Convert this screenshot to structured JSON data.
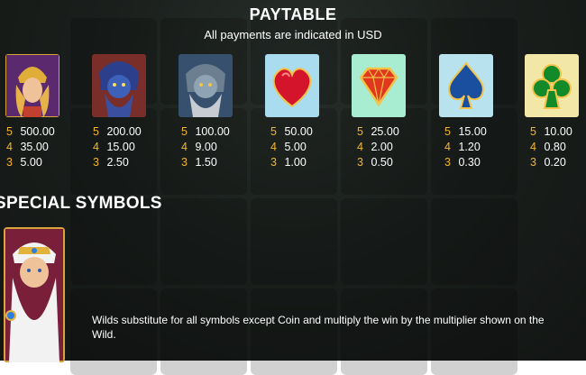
{
  "header": {
    "title": "PAYTABLE",
    "subtitle": "All payments are indicated in USD"
  },
  "symbols": [
    {
      "icon": "goddess-icon",
      "pays": [
        {
          "count": "5",
          "value": "500.00"
        },
        {
          "count": "4",
          "value": "35.00"
        },
        {
          "count": "3",
          "value": "5.00"
        }
      ]
    },
    {
      "icon": "poseidon-icon",
      "pays": [
        {
          "count": "5",
          "value": "200.00"
        },
        {
          "count": "4",
          "value": "15.00"
        },
        {
          "count": "3",
          "value": "2.50"
        }
      ]
    },
    {
      "icon": "zeus-blue-icon",
      "pays": [
        {
          "count": "5",
          "value": "100.00"
        },
        {
          "count": "4",
          "value": "9.00"
        },
        {
          "count": "3",
          "value": "1.50"
        }
      ]
    },
    {
      "icon": "heart-icon",
      "pays": [
        {
          "count": "5",
          "value": "50.00"
        },
        {
          "count": "4",
          "value": "5.00"
        },
        {
          "count": "3",
          "value": "1.00"
        }
      ]
    },
    {
      "icon": "diamond-icon",
      "pays": [
        {
          "count": "5",
          "value": "25.00"
        },
        {
          "count": "4",
          "value": "2.00"
        },
        {
          "count": "3",
          "value": "0.50"
        }
      ]
    },
    {
      "icon": "spade-icon",
      "pays": [
        {
          "count": "5",
          "value": "15.00"
        },
        {
          "count": "4",
          "value": "1.20"
        },
        {
          "count": "3",
          "value": "0.30"
        }
      ]
    },
    {
      "icon": "club-icon",
      "pays": [
        {
          "count": "5",
          "value": "10.00"
        },
        {
          "count": "4",
          "value": "0.80"
        },
        {
          "count": "3",
          "value": "0.20"
        }
      ]
    }
  ],
  "special": {
    "heading": "SPECIAL SYMBOLS",
    "icon": "zeus-wild-icon",
    "description": "Wilds substitute for all symbols except Coin and multiply the win by the multiplier shown on the Wild."
  },
  "colors": {
    "count_color": "#f2b630",
    "heart_tile": "#a9dcef",
    "diamond_tile": "#a8ecd2",
    "spade_tile": "#b7e2ee",
    "club_tile": "#f3e7a8"
  }
}
